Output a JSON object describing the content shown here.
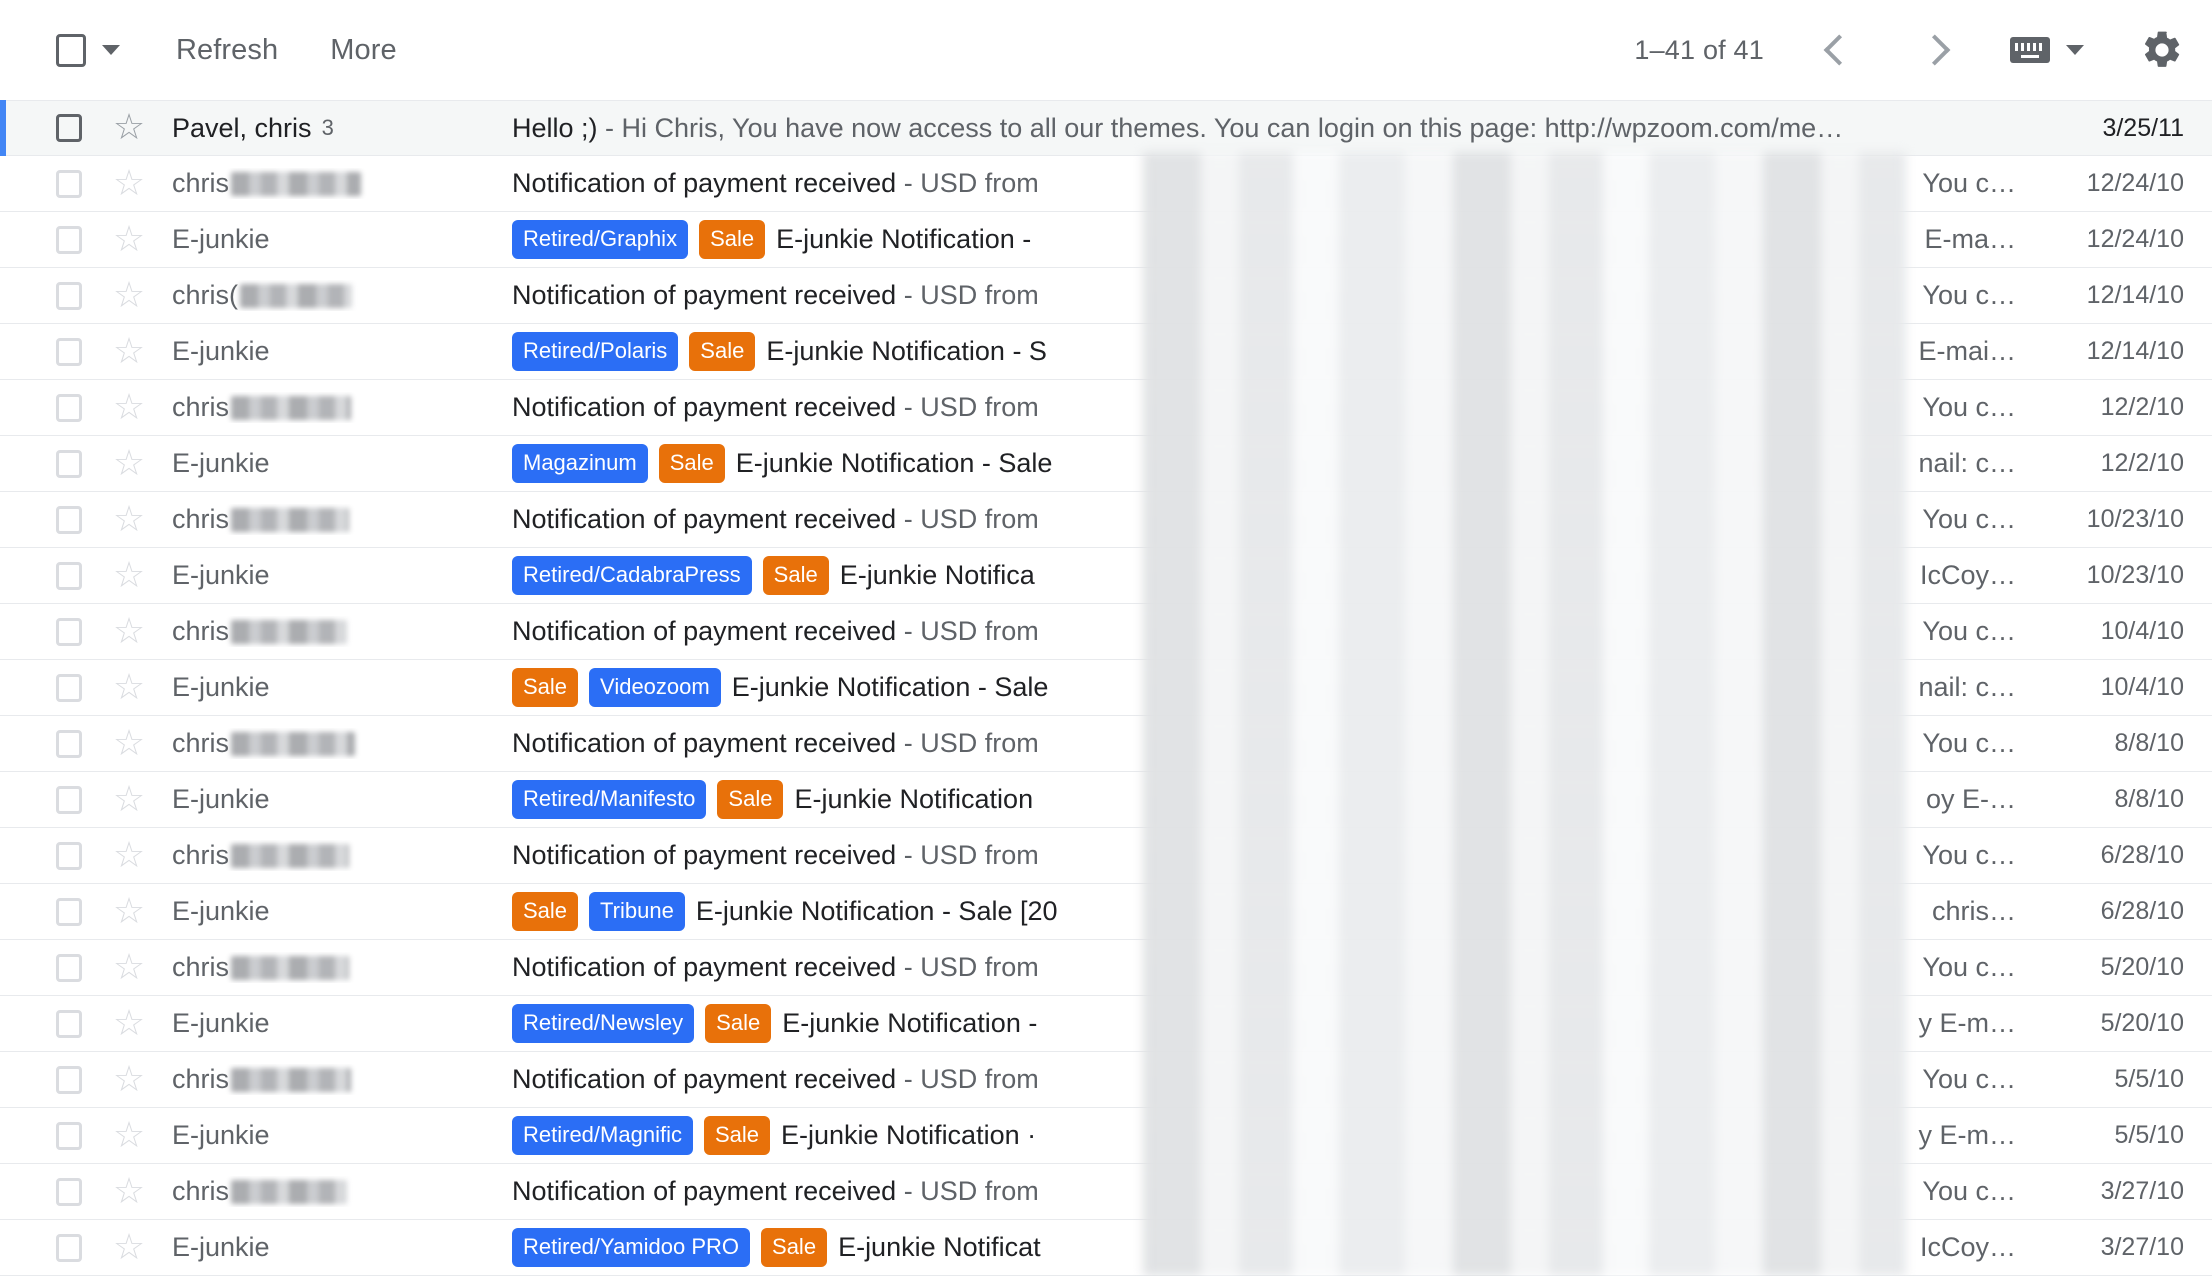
{
  "toolbar": {
    "select_all_icon": "checkbox-icon",
    "select_all_caret_icon": "chevron-down-icon",
    "refresh_label": "Refresh",
    "more_label": "More",
    "pagination_count": "1–41 of 41",
    "prev_icon": "chevron-left-icon",
    "next_icon": "chevron-right-icon",
    "keyboard_icon": "keyboard-icon",
    "keyboard_caret_icon": "chevron-down-icon",
    "settings_icon": "gear-icon"
  },
  "colors": {
    "label_blue": "#2b6ef5",
    "label_orange": "#e8710a",
    "unread_accent": "#4286f5",
    "row_divider": "#e8eaed",
    "text_primary": "#202124",
    "text_secondary": "#5f6368"
  },
  "rows": [
    {
      "unread": true,
      "sender": "Pavel, chris",
      "sender_count": "3",
      "sender_redacted": false,
      "labels": [],
      "subject": "Hello ;)",
      "snippet": " - Hi Chris, You have now access to all our themes. You can login on this page: http://wpzoom.com/me…",
      "tail": "",
      "date": "3/25/11"
    },
    {
      "unread": false,
      "sender": "chris",
      "sender_count": "",
      "sender_redacted": true,
      "redact_width": 130,
      "labels": [],
      "subject": "Notification of payment received",
      "snippet": " - USD from",
      "tail": "You c…",
      "date": "12/24/10"
    },
    {
      "unread": false,
      "sender": "E-junkie",
      "sender_count": "",
      "sender_redacted": false,
      "labels": [
        {
          "text": "Retired/Graphix",
          "color": "blue"
        },
        {
          "text": "Sale",
          "color": "orange"
        }
      ],
      "subject": "E-junkie Notification -",
      "snippet": "",
      "tail": "E-ma…",
      "date": "12/24/10"
    },
    {
      "unread": false,
      "sender": "chris(",
      "sender_count": "",
      "sender_redacted": true,
      "redact_width": 112,
      "labels": [],
      "subject": "Notification of payment received",
      "snippet": " - USD from",
      "tail": "You c…",
      "date": "12/14/10"
    },
    {
      "unread": false,
      "sender": "E-junkie",
      "sender_count": "",
      "sender_redacted": false,
      "labels": [
        {
          "text": "Retired/Polaris",
          "color": "blue"
        },
        {
          "text": "Sale",
          "color": "orange"
        }
      ],
      "subject": "E-junkie Notification - S",
      "snippet": "",
      "tail": "E-mai…",
      "date": "12/14/10"
    },
    {
      "unread": false,
      "sender": "chris",
      "sender_count": "",
      "sender_redacted": true,
      "redact_width": 120,
      "labels": [],
      "subject": "Notification of payment received",
      "snippet": " - USD from",
      "tail": "You c…",
      "date": "12/2/10"
    },
    {
      "unread": false,
      "sender": "E-junkie",
      "sender_count": "",
      "sender_redacted": false,
      "labels": [
        {
          "text": "Magazinum",
          "color": "blue"
        },
        {
          "text": "Sale",
          "color": "orange"
        }
      ],
      "subject": "E-junkie Notification - Sale",
      "snippet": "",
      "tail": "nail: c…",
      "date": "12/2/10"
    },
    {
      "unread": false,
      "sender": "chris",
      "sender_count": "",
      "sender_redacted": true,
      "redact_width": 118,
      "labels": [],
      "subject": "Notification of payment received",
      "snippet": " - USD from",
      "tail": "You c…",
      "date": "10/23/10"
    },
    {
      "unread": false,
      "sender": "E-junkie",
      "sender_count": "",
      "sender_redacted": false,
      "labels": [
        {
          "text": "Retired/CadabraPress",
          "color": "blue"
        },
        {
          "text": "Sale",
          "color": "orange"
        }
      ],
      "subject": "E-junkie Notifica",
      "snippet": "",
      "tail": "IcCoy…",
      "date": "10/23/10"
    },
    {
      "unread": false,
      "sender": "chris",
      "sender_count": "",
      "sender_redacted": true,
      "redact_width": 116,
      "labels": [],
      "subject": "Notification of payment received",
      "snippet": " - USD from",
      "tail": "You c…",
      "date": "10/4/10"
    },
    {
      "unread": false,
      "sender": "E-junkie",
      "sender_count": "",
      "sender_redacted": false,
      "labels": [
        {
          "text": "Sale",
          "color": "orange"
        },
        {
          "text": "Videozoom",
          "color": "blue"
        }
      ],
      "subject": "E-junkie Notification - Sale",
      "snippet": "",
      "tail": "nail: c…",
      "date": "10/4/10"
    },
    {
      "unread": false,
      "sender": "chris",
      "sender_count": "",
      "sender_redacted": true,
      "redact_width": 124,
      "labels": [],
      "subject": "Notification of payment received",
      "snippet": " - USD from",
      "tail": "You c…",
      "date": "8/8/10"
    },
    {
      "unread": false,
      "sender": "E-junkie",
      "sender_count": "",
      "sender_redacted": false,
      "labels": [
        {
          "text": "Retired/Manifesto",
          "color": "blue"
        },
        {
          "text": "Sale",
          "color": "orange"
        }
      ],
      "subject": "E-junkie Notification",
      "snippet": "",
      "tail": "oy E-…",
      "date": "8/8/10"
    },
    {
      "unread": false,
      "sender": "chris",
      "sender_count": "",
      "sender_redacted": true,
      "redact_width": 118,
      "labels": [],
      "subject": "Notification of payment received",
      "snippet": " - USD from",
      "tail": "You c…",
      "date": "6/28/10"
    },
    {
      "unread": false,
      "sender": "E-junkie",
      "sender_count": "",
      "sender_redacted": false,
      "labels": [
        {
          "text": "Sale",
          "color": "orange"
        },
        {
          "text": "Tribune",
          "color": "blue"
        }
      ],
      "subject": "E-junkie Notification - Sale [20",
      "snippet": "",
      "tail": "chris…",
      "date": "6/28/10"
    },
    {
      "unread": false,
      "sender": "chris",
      "sender_count": "",
      "sender_redacted": true,
      "redact_width": 118,
      "labels": [],
      "subject": "Notification of payment received",
      "snippet": " - USD from",
      "tail": "You c…",
      "date": "5/20/10"
    },
    {
      "unread": false,
      "sender": "E-junkie",
      "sender_count": "",
      "sender_redacted": false,
      "labels": [
        {
          "text": "Retired/Newsley",
          "color": "blue"
        },
        {
          "text": "Sale",
          "color": "orange"
        }
      ],
      "subject": "E-junkie Notification -",
      "snippet": "",
      "tail": "y E-m…",
      "date": "5/20/10"
    },
    {
      "unread": false,
      "sender": "chris",
      "sender_count": "",
      "sender_redacted": true,
      "redact_width": 120,
      "labels": [],
      "subject": "Notification of payment received",
      "snippet": " - USD from",
      "tail": "You c…",
      "date": "5/5/10"
    },
    {
      "unread": false,
      "sender": "E-junkie",
      "sender_count": "",
      "sender_redacted": false,
      "labels": [
        {
          "text": "Retired/Magnific",
          "color": "blue"
        },
        {
          "text": "Sale",
          "color": "orange"
        }
      ],
      "subject": "E-junkie Notification ·",
      "snippet": "",
      "tail": "y E-m…",
      "date": "5/5/10"
    },
    {
      "unread": false,
      "sender": "chris",
      "sender_count": "",
      "sender_redacted": true,
      "redact_width": 116,
      "labels": [],
      "subject": "Notification of payment received",
      "snippet": " - USD from",
      "tail": "You c…",
      "date": "3/27/10"
    },
    {
      "unread": false,
      "sender": "E-junkie",
      "sender_count": "",
      "sender_redacted": false,
      "labels": [
        {
          "text": "Retired/Yamidoo PRO",
          "color": "blue"
        },
        {
          "text": "Sale",
          "color": "orange"
        }
      ],
      "subject": "E-junkie Notificat",
      "snippet": "",
      "tail": "IcCoy…",
      "date": "3/27/10"
    }
  ]
}
